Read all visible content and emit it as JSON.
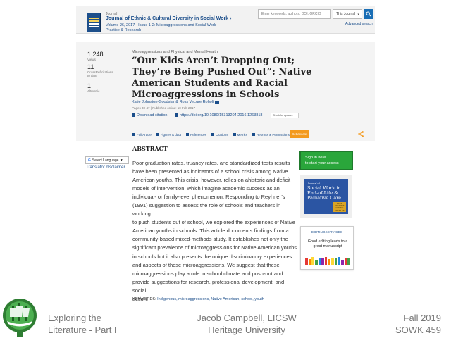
{
  "journal": {
    "kicker": "Journal",
    "title": "Journal of Ethnic & Cultural Diversity in Social Work ›",
    "volume": "Volume 26, 2017 - Issue 1-2: Microaggressions and Social Work",
    "section": "Practice & Research"
  },
  "search": {
    "placeholder": "Enter keywords, authors, DOI, ORCID",
    "scope": "This Journal",
    "advanced": "Advanced search"
  },
  "metrics": {
    "views_value": "1,248",
    "views_label": "Views",
    "crossref_value": "11",
    "crossref_label": "CrossRef citations to date",
    "altmetric_value": "1",
    "altmetric_label": "Altmetric"
  },
  "article": {
    "category": "Microaggressions and Physical and Mental Health",
    "title": "“Our Kids Aren’t Dropping Out; They’re Being Pushed Out”: Native American Students and Racial Microaggressions in Schools",
    "authors": "Katie Johnston-Goodstar & Ross VeLure Roholt",
    "pages": "Pages 30-47 | Published online: 10 Feb 2017",
    "download_citation": "Download citation",
    "doi": "https://doi.org/10.1080/15313204.2016.1263818",
    "check_updates": "Check for updates"
  },
  "tabs": [
    "Full Article",
    "Figures & data",
    "References",
    "Citations",
    "Metrics",
    "Reprints & Permissions"
  ],
  "get_access": "Get access",
  "translate": {
    "select_label": "Select Language ▼",
    "disclaimer": "Translator disclaimer"
  },
  "abstract": {
    "heading": "ABSTRACT",
    "lines": [
      "Poor graduation rates, truancy rates, and standardized tests results",
      "have been presented as indicators of a school crisis among Native",
      "American youths. This crisis, however, relies on ahistoric and deficit",
      "models of intervention, which imagine academic success as an",
      "individual- or family-level phenomenon. Responding to Reyhner’s",
      "(1991) suggestion to assess the role of schools and teachers in working",
      "to push students out of school, we explored the experiences of Native",
      "American youths in schools. This article documents findings from a",
      "community-based mixed-methods study. It establishes not only the",
      "significant prevalence of microaggressions for Native American youths",
      "in schools but it also presents the unique discriminatory experiences",
      "and aspects of those microaggressions. We suggest that these",
      "microaggressions play a role in school climate and push-out and",
      "provide suggestions for research, professional development, and social",
      "action."
    ]
  },
  "keywords": {
    "label": "KEYWORDS: ",
    "items": "Indigenous, microaggressions, Native American, school, youth"
  },
  "sidebar": {
    "signin_line1": "Sign in here",
    "signin_line2": "to start your access",
    "ad1_kicker": "Journal of",
    "ad1_title": "Social Work in End-of-Life & Palliative Care",
    "ad1_badge": "READ EDITOR'S CHOICE ARTICLES",
    "ad2_title": "EDITINGSERVICES",
    "ad2_text": "Good editing leads to a great manuscript"
  },
  "footer": {
    "left_line1": "Exploring the",
    "left_line2": "Literature - Part I",
    "mid_line1": "Jacob Campbell, LICSW",
    "mid_line2": "Heritage University",
    "right_line1": "Fall 2019",
    "right_line2": "SOWK 459"
  },
  "colors": {
    "link": "#1a4d8a",
    "access": "#f39a1e",
    "signin": "#2aa63b",
    "logo_green": "#2e7d32"
  }
}
